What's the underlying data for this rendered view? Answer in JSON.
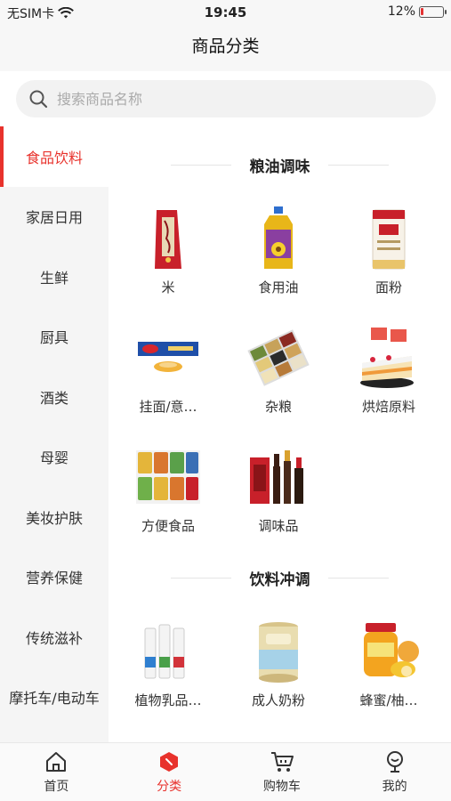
{
  "status_bar": {
    "carrier": "无SIM卡",
    "time": "19:45",
    "battery": "12%",
    "battery_level": 0.12,
    "battery_color": "#e33333"
  },
  "header": {
    "title": "商品分类"
  },
  "search": {
    "placeholder": "搜索商品名称"
  },
  "sidebar": {
    "items": [
      {
        "label": "食品饮料",
        "active": true
      },
      {
        "label": "家居日用"
      },
      {
        "label": "生鲜"
      },
      {
        "label": "厨具"
      },
      {
        "label": "酒类"
      },
      {
        "label": "母婴"
      },
      {
        "label": "美妆护肤"
      },
      {
        "label": "营养保健"
      },
      {
        "label": "传统滋补"
      },
      {
        "label": "摩托车/电动车"
      }
    ]
  },
  "content": {
    "sections": [
      {
        "title": "粮油调味",
        "items": [
          {
            "label": "米",
            "icon": "rice-bag-icon"
          },
          {
            "label": "食用油",
            "icon": "cooking-oil-icon"
          },
          {
            "label": "面粉",
            "icon": "flour-bag-icon"
          },
          {
            "label": "挂面/意…",
            "icon": "pasta-icon"
          },
          {
            "label": "杂粮",
            "icon": "grains-icon"
          },
          {
            "label": "烘焙原料",
            "icon": "cake-icon"
          },
          {
            "label": "方便食品",
            "icon": "instant-noodles-icon"
          },
          {
            "label": "调味品",
            "icon": "condiments-icon"
          }
        ]
      },
      {
        "title": "饮料冲调",
        "items": [
          {
            "label": "植物乳品…",
            "icon": "plant-milk-icon"
          },
          {
            "label": "成人奶粉",
            "icon": "milk-powder-icon"
          },
          {
            "label": "蜂蜜/柚…",
            "icon": "honey-jar-icon"
          }
        ]
      }
    ]
  },
  "tabbar": {
    "items": [
      {
        "label": "首页",
        "icon": "home-icon"
      },
      {
        "label": "分类",
        "icon": "category-icon",
        "active": true
      },
      {
        "label": "购物车",
        "icon": "cart-icon"
      },
      {
        "label": "我的",
        "icon": "profile-icon"
      }
    ]
  },
  "colors": {
    "accent": "#e8322c"
  }
}
